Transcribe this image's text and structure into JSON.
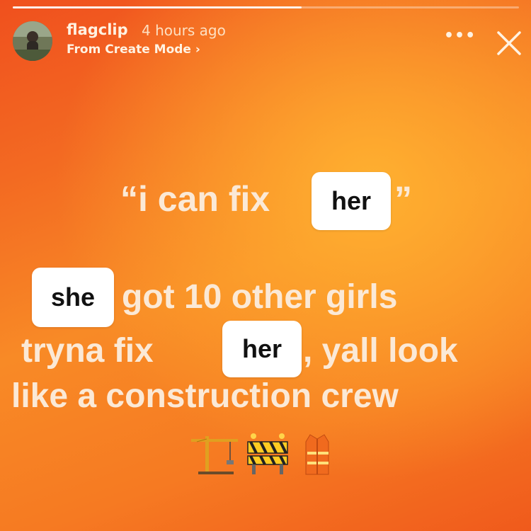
{
  "story": {
    "progress_fraction": 0.57,
    "username": "flagclip",
    "time": "4 hours ago",
    "subtitle": "From Create Mode ›",
    "more_label": "•••",
    "colors": {
      "background_start": "#f0501e",
      "background_mid": "#f88a26",
      "text": "#fbe9d6",
      "sticker": "#ffffff"
    }
  },
  "caption": {
    "quote_start": "“i can fix",
    "sticker1": "her",
    "quote_end": "”",
    "sticker2": "she",
    "line2": "got 10 other girls",
    "line3a": "tryna fix",
    "sticker3": "her",
    "line3b": ", yall look",
    "line4": "like a construction crew",
    "emoji_names": [
      "construction-crane-icon",
      "construction-barrier-icon",
      "safety-vest-icon"
    ]
  }
}
